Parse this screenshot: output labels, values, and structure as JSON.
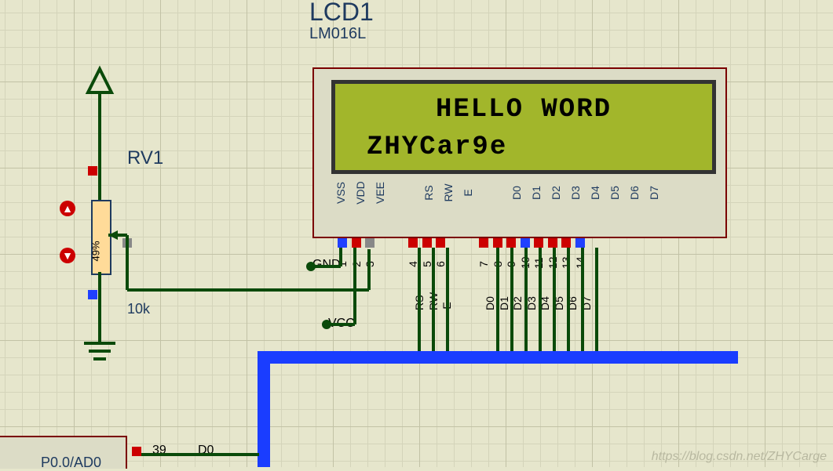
{
  "lcd": {
    "ref": "LCD1",
    "part": "LM016L",
    "line1": "HELLO WORD",
    "line2": "ZHYCar9e",
    "pins": [
      {
        "name": "VSS",
        "num": "1"
      },
      {
        "name": "VDD",
        "num": "2"
      },
      {
        "name": "VEE",
        "num": "3"
      },
      {
        "name": "RS",
        "num": "4"
      },
      {
        "name": "RW",
        "num": "5"
      },
      {
        "name": "E",
        "num": "6"
      },
      {
        "name": "D0",
        "num": "7"
      },
      {
        "name": "D1",
        "num": "8"
      },
      {
        "name": "D2",
        "num": "9"
      },
      {
        "name": "D3",
        "num": "10"
      },
      {
        "name": "D4",
        "num": "11"
      },
      {
        "name": "D5",
        "num": "12"
      },
      {
        "name": "D6",
        "num": "13"
      },
      {
        "name": "D7",
        "num": "14"
      }
    ],
    "wires": [
      "RS",
      "RW",
      "E",
      "D0",
      "D1",
      "D2",
      "D3",
      "D4",
      "D5",
      "D6",
      "D7"
    ]
  },
  "pot": {
    "ref": "RV1",
    "value": "10k",
    "percent": "49%"
  },
  "nets": {
    "gnd": "GND",
    "vcc": "VCC"
  },
  "mcu": {
    "pinlabel": "P0.0/AD0",
    "pinnum": "39",
    "wire": "D0"
  },
  "watermark": "https://blog.csdn.net/ZHYCarge"
}
